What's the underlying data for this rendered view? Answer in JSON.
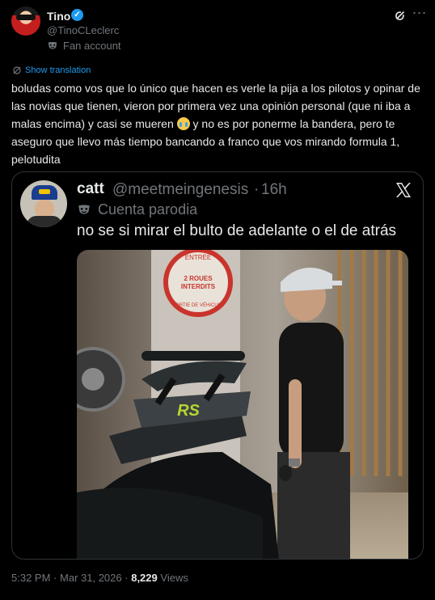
{
  "author": {
    "name": "Tino",
    "handle": "@TinoCLeclerc",
    "label": "Fan account"
  },
  "post": {
    "translate_label": "Show translation",
    "text_part1": "boludas como vos que lo único que hacen es verle la pija a los pilotos y opinar de las novias que tienen, vieron por primera vez una opinión personal (que ni iba a malas encima) y casi se mueren ",
    "text_part2": " y no es por ponerme la bandera, pero te aseguro que llevo más tiempo bancando a franco que vos mirando formula 1, pelotudita",
    "emoji": "loudly-crying-face-emoji"
  },
  "quote": {
    "name": "catt",
    "handle": "@meetmeingenesis",
    "separator": "·",
    "time": "16h",
    "label": "Cuenta parodia",
    "text": "no se si mirar el bulto de adelante o el de atrás",
    "media": {
      "sign_line1": "2 ROUES",
      "sign_line2": "INTERDITS",
      "sign_arc_top": "ENTRÉE",
      "sign_arc_bottom": "SORTIE DE VÉHICULE",
      "wing_badge": "RS",
      "accent": "#b6d531"
    }
  },
  "footer": {
    "time": "5:32 PM",
    "dot1": "·",
    "date": "Mar 31, 2026",
    "dot2": "·",
    "views_count": "8,229",
    "views_label": "Views"
  },
  "colors": {
    "background": "#000000",
    "text": "#e7e9ea",
    "muted": "#71767b",
    "link": "#1d9bf0",
    "border": "#2f3336"
  }
}
